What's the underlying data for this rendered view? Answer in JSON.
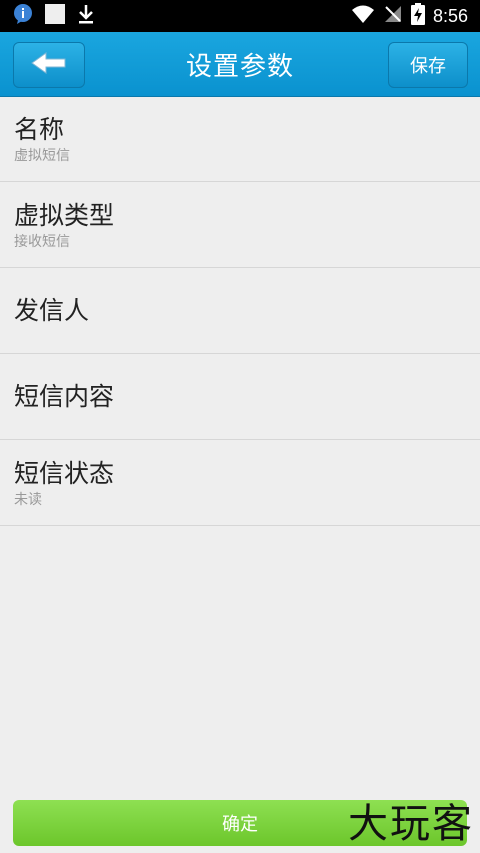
{
  "statusbar": {
    "time": "8:56"
  },
  "appbar": {
    "title": "设置参数",
    "save_label": "保存"
  },
  "items": [
    {
      "title": "名称",
      "sub": "虚拟短信"
    },
    {
      "title": "虚拟类型",
      "sub": "接收短信"
    },
    {
      "title": "发信人",
      "sub": ""
    },
    {
      "title": "短信内容",
      "sub": ""
    },
    {
      "title": "短信状态",
      "sub": "未读"
    }
  ],
  "confirm_label": "确定",
  "watermark": "大玩客"
}
